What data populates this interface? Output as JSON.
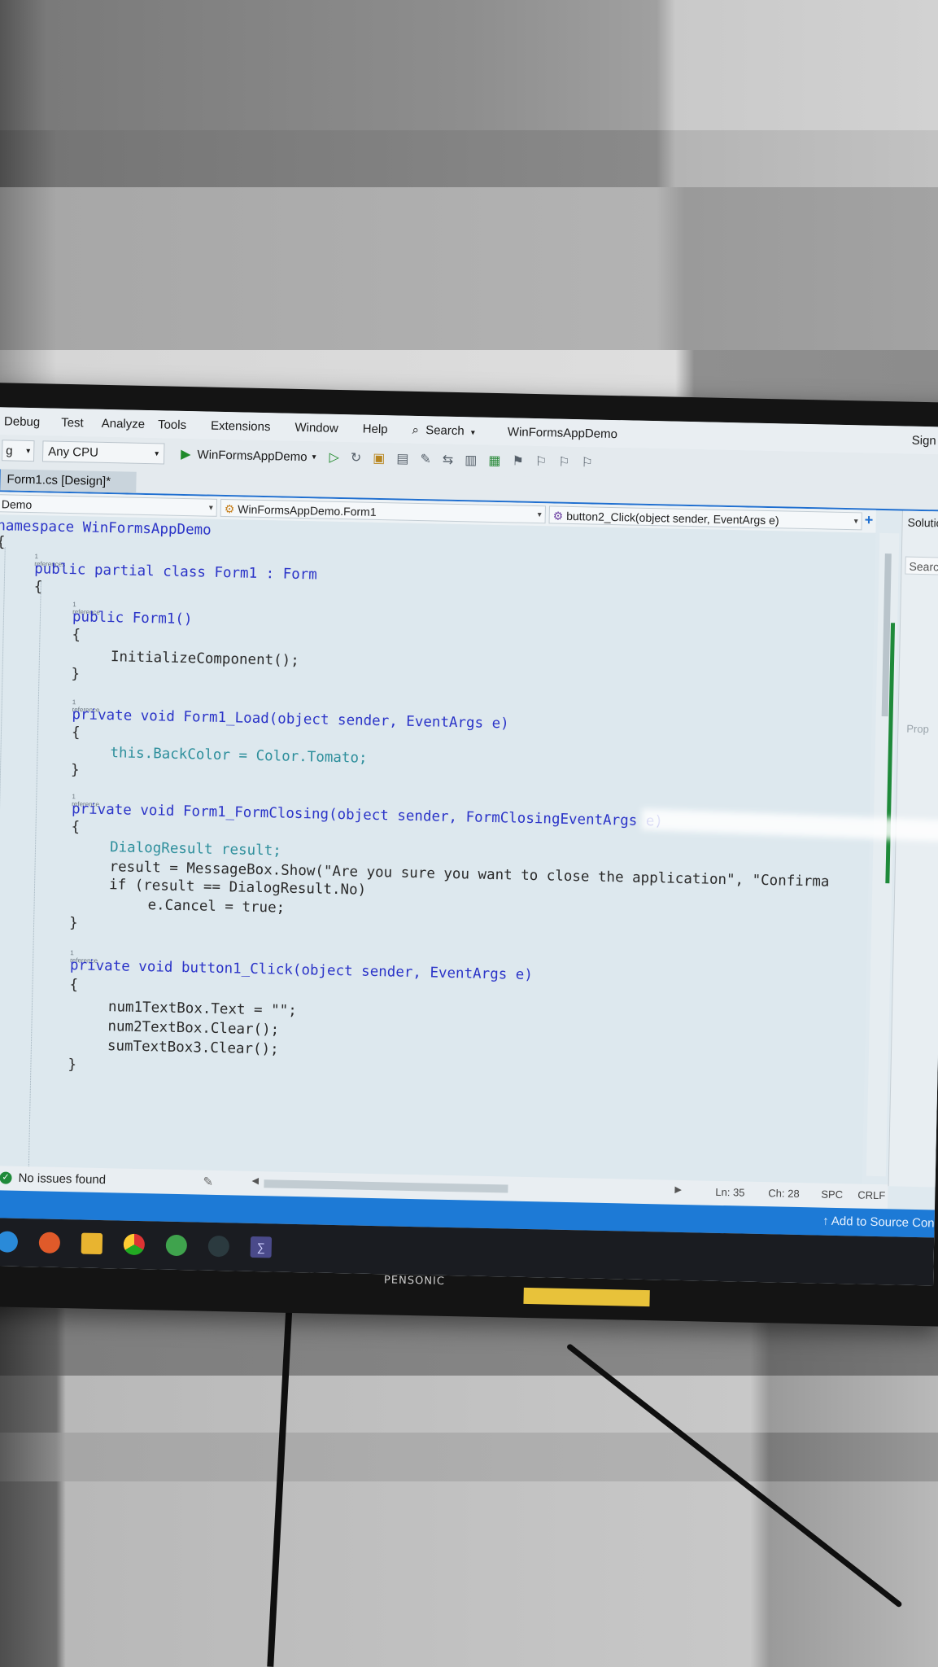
{
  "menu": {
    "items": [
      "Debug",
      "Test",
      "Analyze",
      "Tools",
      "Extensions",
      "Window",
      "Help"
    ],
    "search_label": "Search",
    "project_title": "WinFormsAppDemo",
    "sign_in": "Sign"
  },
  "toolbar": {
    "config_value": "g",
    "platform_value": "Any CPU",
    "run_target": "WinFormsAppDemo"
  },
  "tab": {
    "label": "Form1.cs [Design]*"
  },
  "nav": {
    "project": "Demo",
    "class": "WinFormsAppDemo.Form1",
    "member": "button2_Click(object sender, EventArgs e)"
  },
  "code": {
    "ref1": "1 references",
    "ref_single": "1 reference",
    "lines": [
      "namespace WinFormsAppDemo",
      "{",
      "public partial class Form1 : Form",
      "{",
      "public Form1()",
      "{",
      "InitializeComponent();",
      "}",
      "private void Form1_Load(object sender, EventArgs e)",
      "{",
      "this.BackColor = Color.Tomato;",
      "}",
      "private void Form1_FormClosing(object sender, FormClosingEventArgs e)",
      "{",
      "DialogResult result;",
      "result = MessageBox.Show(\"Are you sure you want to close the application\", \"Confirma",
      "if (result == DialogResult.No)",
      "e.Cancel = true;",
      "}",
      "private void button1_Click(object sender, EventArgs e)",
      "{",
      "num1TextBox.Text = \"\";",
      "num2TextBox.Clear();",
      "sumTextBox3.Clear();",
      "}"
    ]
  },
  "solution": {
    "title": "Solution",
    "search": "Search",
    "props": "Prop"
  },
  "status": {
    "issues": "No issues found",
    "line": "Ln: 35",
    "col": "Ch: 28",
    "spc": "SPC",
    "eol": "CRLF",
    "source_control": "Add to Source Con"
  },
  "monitor": {
    "brand": "PENSONIC"
  }
}
